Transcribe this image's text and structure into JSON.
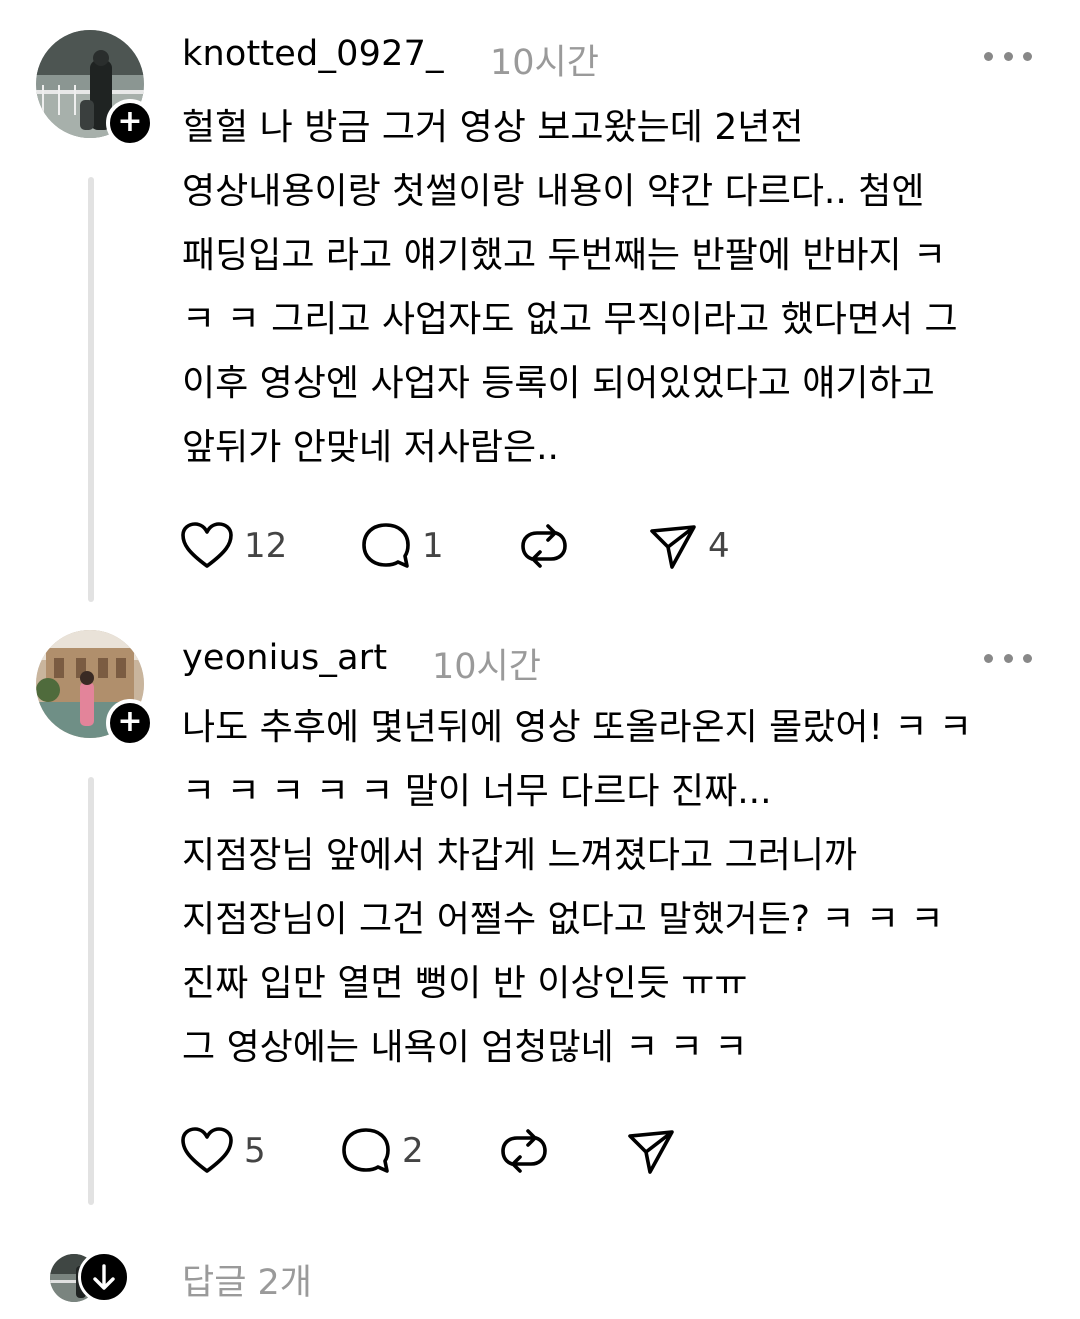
{
  "comments": [
    {
      "username": "knotted_0927_",
      "time": "10시간",
      "text": "헐헐 나 방금 그거 영상 보고왔는데 2년전\n영상내용이랑 첫썰이랑 내용이 약간 다르다.. 첨엔\n패딩입고 라고 얘기했고 두번째는 반팔에 반바지 ㅋ\nㅋ ㅋ 그리고 사업자도 없고 무직이라고 했다면서 그\n이후 영상엔 사업자 등록이 되어있었다고 얘기하고\n앞뒤가 안맞네 저사람은..",
      "likes": "12",
      "replies": "1",
      "shares": "4"
    },
    {
      "username": "yeonius_art",
      "time": "10시간",
      "text": "나도 추후에 몇년뒤에 영상 또올라온지 몰랐어! ㅋ ㅋ\nㅋ ㅋ ㅋ ㅋ ㅋ 말이 너무 다르다 진짜...\n지점장님 앞에서 차갑게 느껴졌다고 그러니까\n지점장님이 그건 어쩔수 없다고 말했거든? ㅋ ㅋ ㅋ\n진짜 입만 열면 뻥이 반 이상인듯 ㅠㅠ\n그 영상에는 내욕이 엄청많네 ㅋ ㅋ ㅋ",
      "likes": "5",
      "replies": "2"
    }
  ],
  "reply_summary": "답글 2개",
  "icons": {
    "like": "heart-icon",
    "comment": "comment-bubble-icon",
    "repost": "repost-icon",
    "share": "send-icon",
    "more": "more-dots-icon",
    "follow": "plus-icon",
    "expand": "arrow-down-icon"
  }
}
